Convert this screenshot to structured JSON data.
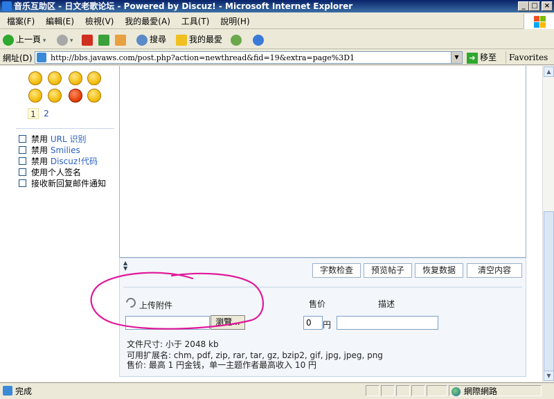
{
  "window": {
    "title": "音乐互助区 - 日文老歌论坛 - Powered by Discuz! - Microsoft Internet Explorer",
    "minimize": "_",
    "maximize": "□",
    "close": "×"
  },
  "menu": {
    "items": [
      "檔案(F)",
      "編輯(E)",
      "檢視(V)",
      "我的最愛(A)",
      "工具(T)",
      "說明(H)"
    ]
  },
  "toolbar": {
    "back": "上一頁",
    "search": "搜尋",
    "favorites": "我的最愛"
  },
  "address": {
    "label": "網址(D)",
    "url": "http://bbs.javaws.com/post.php?action=newthread&fid=19&extra=page%3D1",
    "go": "移至",
    "favorites_link": "Favorites"
  },
  "sidebar": {
    "pages": [
      "1",
      "2"
    ],
    "options": [
      {
        "prefix": "禁用 ",
        "text": "URL 识别"
      },
      {
        "prefix": "禁用 ",
        "text": "Smilies"
      },
      {
        "prefix": "禁用 ",
        "text": "Discuz!代码"
      },
      {
        "prefix": "",
        "text": "使用个人签名"
      },
      {
        "prefix": "",
        "text": "接收新回复邮件通知"
      }
    ]
  },
  "editor": {
    "buttons": [
      "字数检查",
      "预览帖子",
      "恢复数据",
      "清空内容"
    ]
  },
  "attachment": {
    "label": "上传附件",
    "price_label": "售价",
    "desc_label": "描述",
    "browse": "瀏覽...",
    "price_value": "0",
    "price_unit": "円",
    "info": [
      "文件尺寸: 小于 2048 kb",
      "可用扩展名: chm, pdf, zip, rar, tar, gz, bzip2, gif, jpg, jpeg, png",
      "售价: 最高 1 円金钱，单一主题作者最高收入 10 円"
    ]
  },
  "status": {
    "text": "完成",
    "zone": "網際網路"
  },
  "colors": {
    "titlebar": "#0a246a",
    "annotation": "#e0189a"
  }
}
